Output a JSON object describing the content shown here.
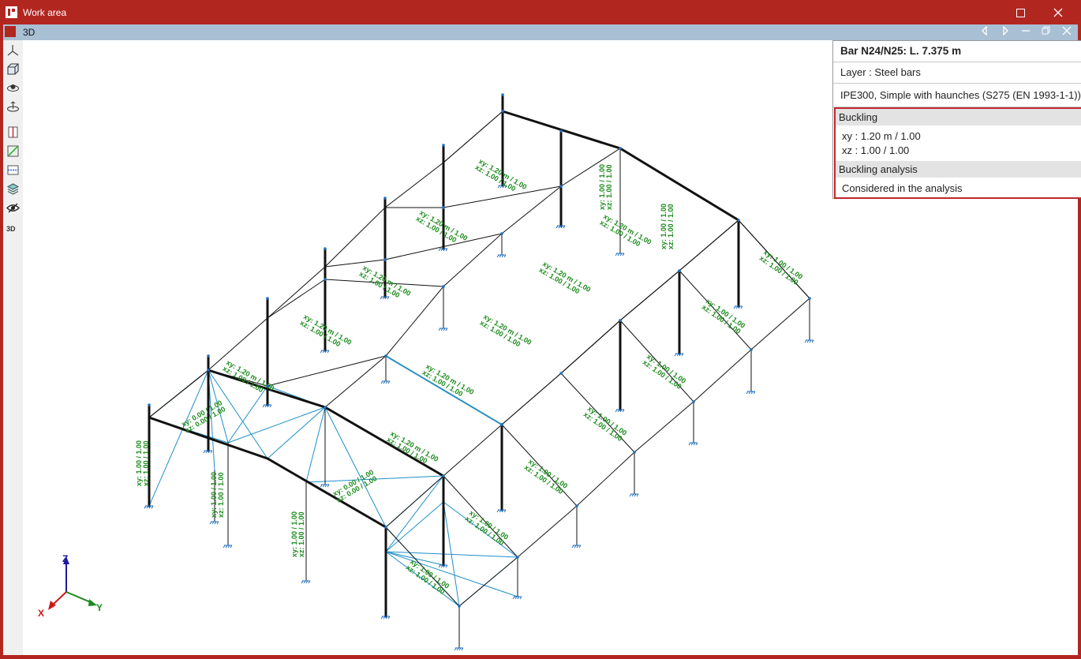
{
  "window": {
    "title": "Work area"
  },
  "view": {
    "tab": "3D"
  },
  "toolbar": {
    "tools": [
      "axes-icon",
      "cube-view-icon",
      "orbit-icon",
      "pan-icon",
      "section-icon",
      "diagonal-icon",
      "plane-icon",
      "layers-icon",
      "visibility-icon",
      "3d-settings-icon"
    ],
    "tool_3d_label": "3D"
  },
  "info_panel": {
    "heading": "Bar N24/N25: L. 7.375 m",
    "layer": "Layer : Steel bars",
    "section": "IPE300, Simple with haunches (S275 (EN 1993-1-1))",
    "buckling_title": "Buckling",
    "buckling_xy": "xy : 1.20 m / 1.00",
    "buckling_xz": "xz : 1.00 / 1.00",
    "analysis_title": "Buckling analysis",
    "analysis_value": "Considered in the analysis"
  },
  "model_labels": {
    "rafter": [
      "xy: 1.20 m / 1.00",
      "xz: 1.00 / 1.00"
    ],
    "column": [
      "xy: 1.00 / 1.00",
      "xz: 1.00 / 1.00"
    ],
    "front_col": [
      "xy: 1.00 / 1.00",
      "xz: 1.00 / 1.00"
    ],
    "wind": [
      "xy: 0.00 / 1.00",
      "xz: 0.00 / 1.00"
    ],
    "gable_beam": [
      "xy: 1.00 / 1.00",
      "xz: 1.00 / 1.00"
    ]
  },
  "axes": {
    "z": "Z",
    "x": "X",
    "y": "Y"
  },
  "colors": {
    "frame": "#111111",
    "bracing": "#1e90c8",
    "selected": "#2a8fc0",
    "label": "#1a8a1a",
    "support": "#1e6fbf",
    "accent": "#c1272d"
  }
}
